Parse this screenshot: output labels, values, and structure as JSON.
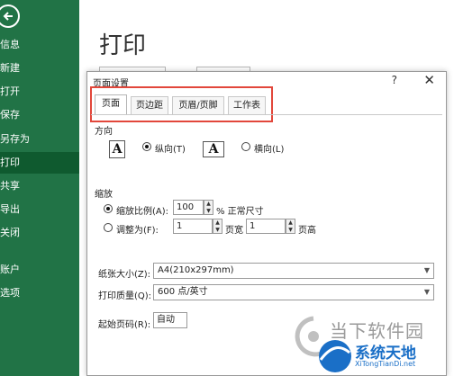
{
  "backstage": {
    "title": "打印",
    "nav": [
      {
        "label": "信息",
        "active": false
      },
      {
        "label": "新建",
        "active": false
      },
      {
        "label": "打开",
        "active": false
      },
      {
        "label": "保存",
        "active": false
      },
      {
        "label": "另存为",
        "active": false
      },
      {
        "label": "打印",
        "active": true
      },
      {
        "label": "共享",
        "active": false
      },
      {
        "label": "导出",
        "active": false
      },
      {
        "label": "关闭",
        "active": false
      },
      {
        "label": "账户",
        "active": false
      },
      {
        "label": "选项",
        "active": false
      }
    ],
    "back_icon": "back-arrow-icon",
    "sidebar_color": "#217346"
  },
  "dialog": {
    "title": "页面设置",
    "help_label": "?",
    "close_label": "✕",
    "tabs": [
      {
        "label": "页面",
        "active": true
      },
      {
        "label": "页边距",
        "active": false
      },
      {
        "label": "页眉/页脚",
        "active": false
      },
      {
        "label": "工作表",
        "active": false
      }
    ],
    "orientation": {
      "section_label": "方向",
      "portrait_label": "纵向(T)",
      "landscape_label": "横向(L)",
      "portrait_icon_letter": "A",
      "landscape_icon_letter": "A",
      "selected": "portrait"
    },
    "scaling": {
      "section_label": "缩放",
      "adjust_label": "缩放比例(A):",
      "adjust_value": "100",
      "adjust_suffix": "% 正常尺寸",
      "fit_label": "调整为(F):",
      "fit_wide_value": "1",
      "fit_wide_suffix": "页宽",
      "fit_tall_value": "1",
      "fit_tall_suffix": "页高",
      "selected": "adjust"
    },
    "paper_size": {
      "label": "纸张大小(Z):",
      "value": "A4(210x297mm)"
    },
    "print_quality": {
      "label": "打印质量(Q):",
      "value": "600 点/英寸"
    },
    "first_page_number": {
      "label": "起始页码(R):",
      "value": "自动"
    },
    "highlight_color": "#e2473b"
  },
  "watermark": {
    "brand_1": "当下软件园",
    "brand_2": "系统天地",
    "brand_2_url": "XiTongTianDi.net"
  }
}
